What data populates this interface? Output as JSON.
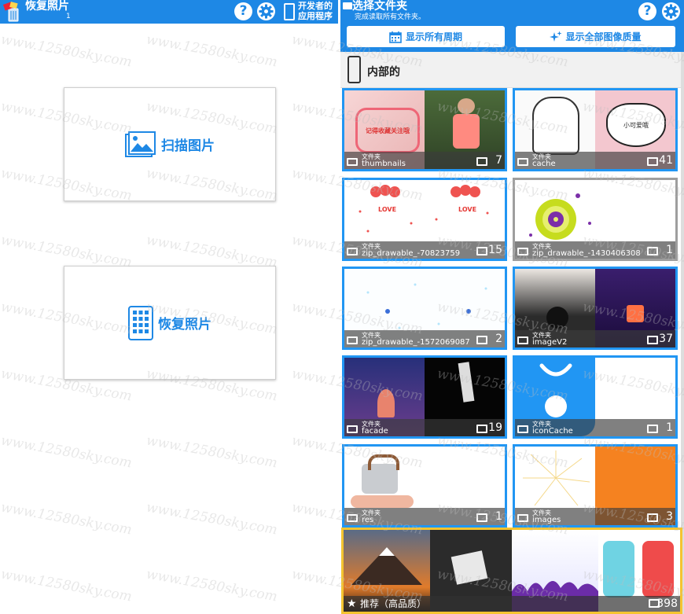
{
  "left": {
    "title": "恢复照片",
    "subtitle": "1",
    "scan_label": "扫描图片",
    "recover_label": "恢复照片"
  },
  "dev": {
    "line1": "开发者的",
    "line2": "应用程序"
  },
  "right": {
    "title": "选择文件夹",
    "subtitle": "完成读取所有文件夹。",
    "periods_label": "显示所有周期",
    "quality_label": "显示全部图像质量",
    "section_label": "内部的"
  },
  "folders": [
    {
      "kind": "文件夹",
      "name": "thumbnails",
      "count": "7"
    },
    {
      "kind": "文件夹",
      "name": "cache",
      "count": "41"
    },
    {
      "kind": "文件夹",
      "name": "zip_drawable_-70823759",
      "count": "15"
    },
    {
      "kind": "文件夹",
      "name": "zip_drawable_-1430406308",
      "count": "1"
    },
    {
      "kind": "文件夹",
      "name": "zip_drawable_-1572069087",
      "count": "2"
    },
    {
      "kind": "文件夹",
      "name": "imageV2",
      "count": "37"
    },
    {
      "kind": "文件夹",
      "name": "facade",
      "count": "19"
    },
    {
      "kind": "文件夹",
      "name": "iconCache",
      "count": "1"
    },
    {
      "kind": "文件夹",
      "name": "res",
      "count": "1"
    },
    {
      "kind": "文件夹",
      "name": "images",
      "count": "3"
    }
  ],
  "thumb_texts": {
    "stamp": "记得收藏关注哦",
    "heart": "小可爱哦",
    "love": "LOVE"
  },
  "recommended": {
    "label": "推荐（高品质）",
    "count": "398"
  },
  "watermark": "www.12580sky.com",
  "colors": {
    "accent": "#1e88e5",
    "tile_border": "#2196f3",
    "recommended_border": "#f4c430"
  }
}
